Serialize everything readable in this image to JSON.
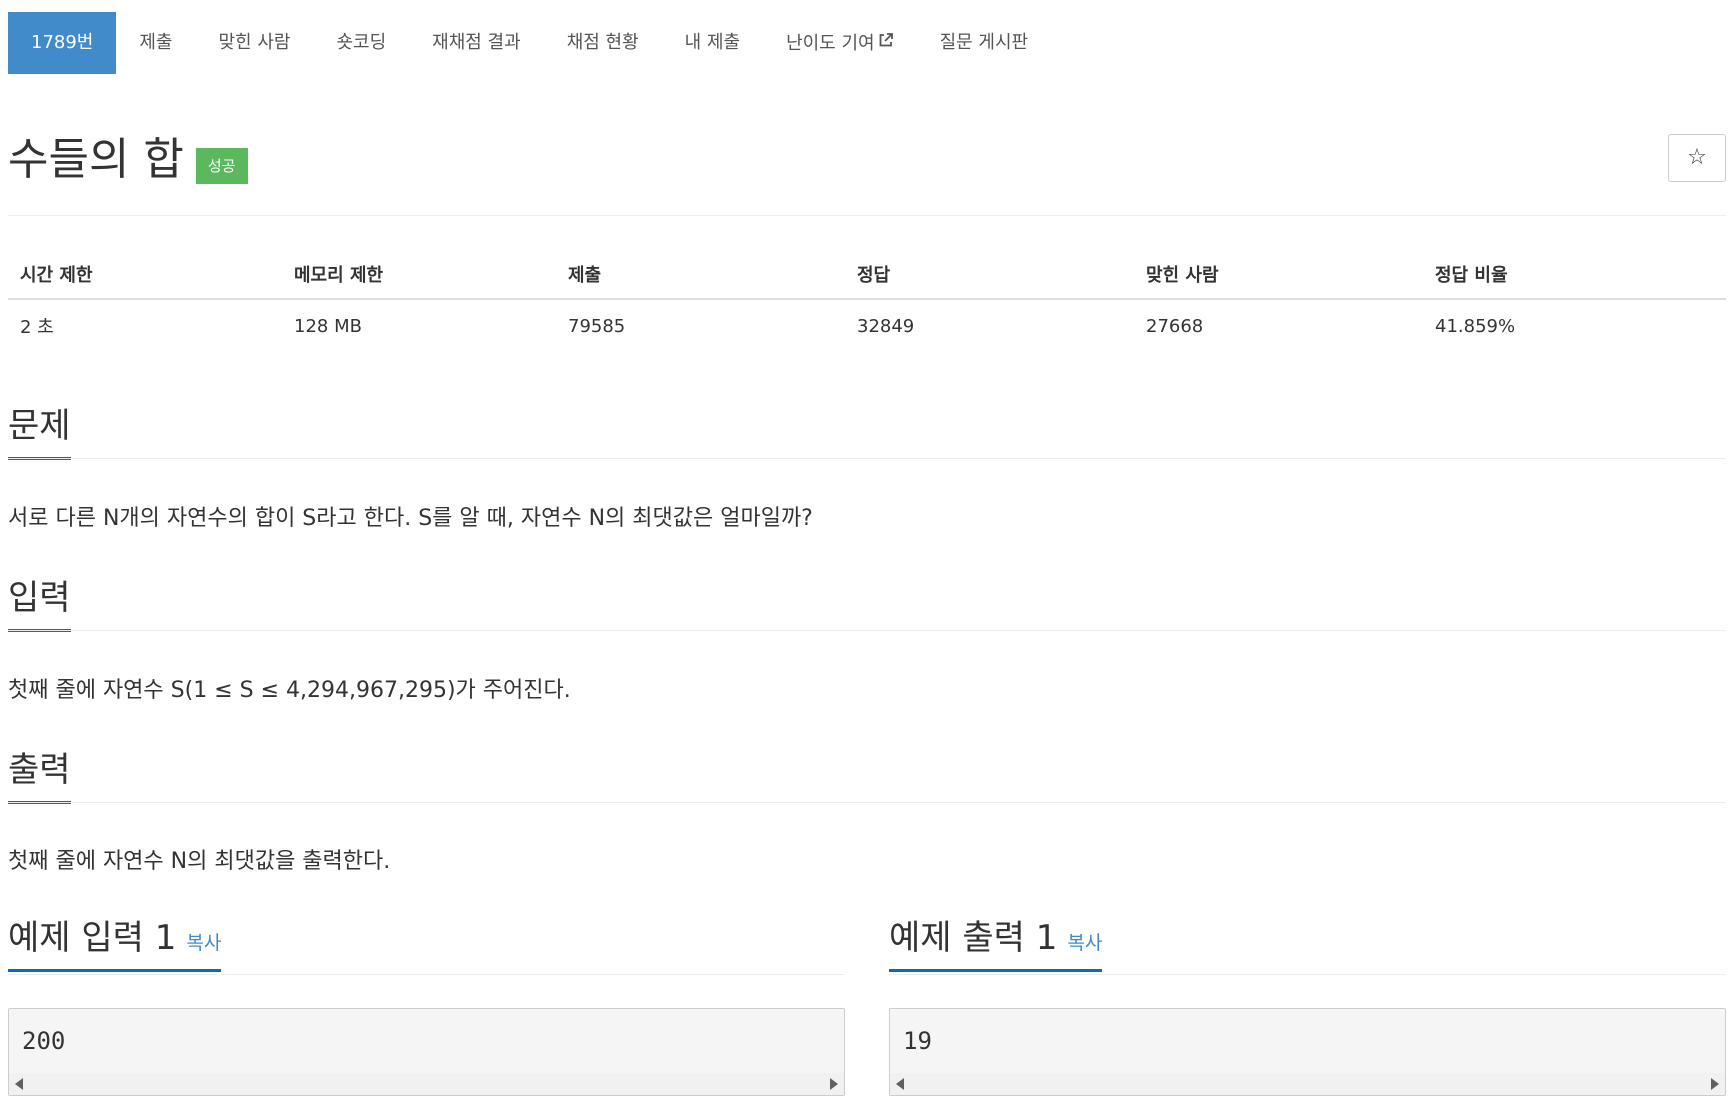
{
  "nav": {
    "items": [
      {
        "label": "1789번",
        "active": true
      },
      {
        "label": "제출"
      },
      {
        "label": "맞힌 사람"
      },
      {
        "label": "숏코딩"
      },
      {
        "label": "재채점 결과"
      },
      {
        "label": "채점 현황"
      },
      {
        "label": "내 제출"
      },
      {
        "label": "난이도 기여",
        "icon": "external-link-icon"
      },
      {
        "label": "질문 게시판"
      }
    ]
  },
  "problem": {
    "title": "수들의 합",
    "badge": "성공",
    "star_icon": "☆"
  },
  "info_table": {
    "headers": [
      "시간 제한",
      "메모리 제한",
      "제출",
      "정답",
      "맞힌 사람",
      "정답 비율"
    ],
    "row": [
      "2 초",
      "128 MB",
      "79585",
      "32849",
      "27668",
      "41.859%"
    ]
  },
  "sections": {
    "problem_title": "문제",
    "problem_text": "서로 다른 N개의 자연수의 합이 S라고 한다. S를 알 때, 자연수 N의 최댓값은 얼마일까?",
    "input_title": "입력",
    "input_text": "첫째 줄에 자연수 S(1 ≤ S ≤ 4,294,967,295)가 주어진다.",
    "output_title": "출력",
    "output_text": "첫째 줄에 자연수 N의 최댓값을 출력한다."
  },
  "samples": {
    "input_title": "예제 입력 1",
    "output_title": "예제 출력 1",
    "copy_label": "복사",
    "input_value": "200",
    "output_value": "19"
  },
  "colors": {
    "accent": "#428bca",
    "success": "#5cb85c",
    "section_underline": "#0c6db5"
  }
}
